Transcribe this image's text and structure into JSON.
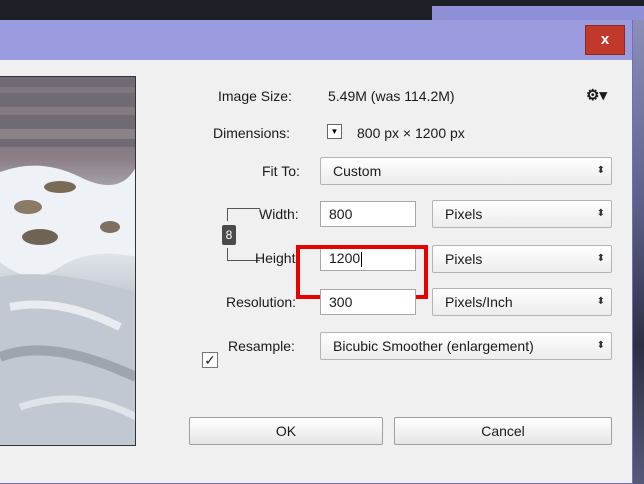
{
  "dialog": {
    "close_label": "x",
    "image_size": {
      "label": "Image Size:",
      "value": "5.49M (was 114.2M)"
    },
    "settings_icon": "gear-icon",
    "dimensions": {
      "label": "Dimensions:",
      "value": "800 px  ×  1200 px"
    },
    "fit_to": {
      "label": "Fit To:",
      "value": "Custom"
    },
    "width": {
      "label": "Width:",
      "value": "800",
      "unit": "Pixels"
    },
    "height": {
      "label": "Height:",
      "value": "1200",
      "unit": "Pixels"
    },
    "resolution": {
      "label": "Resolution:",
      "value": "300",
      "unit": "Pixels/Inch"
    },
    "resample": {
      "label": "Resample:",
      "checked": true,
      "value": "Bicubic Smoother (enlargement)"
    },
    "ok_label": "OK",
    "cancel_label": "Cancel"
  },
  "colors": {
    "title_bar": "#9b9be0",
    "close_button": "#c0392b",
    "highlight": "#e60000"
  }
}
